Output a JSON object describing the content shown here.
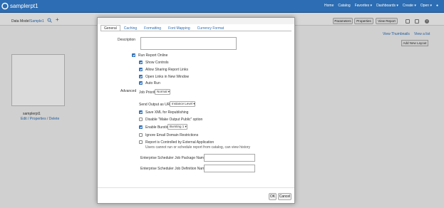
{
  "header": {
    "title": "samplerpt1",
    "nav": [
      "Home",
      "Catalog",
      "Favorites ▾",
      "Dashboards ▾",
      "Create ▾",
      "Open ▾"
    ],
    "brand_color": "#2c6db3"
  },
  "background": {
    "data_model_label": "Data Model",
    "data_model_value": "Sample1",
    "toolbar": {
      "parameters": "Parameters",
      "properties": "Properties",
      "view_report": "View Report"
    },
    "view_thumbnails": "View Thumbnails",
    "view_list": "View a list",
    "add_layout": "Add New Layout",
    "thumbnail": {
      "name": "samplerpt1",
      "edit": "Edit",
      "properties": "Properties",
      "delete": "Delete",
      "sep": "/"
    }
  },
  "dialog": {
    "tabs": [
      {
        "label": "General",
        "active": true
      },
      {
        "label": "Caching",
        "active": false
      },
      {
        "label": "Formatting",
        "active": false
      },
      {
        "label": "Font Mapping",
        "active": false
      },
      {
        "label": "Currency Format",
        "active": false
      }
    ],
    "description_label": "Description",
    "description_value": "",
    "run_online": {
      "label": "Run Report Online",
      "checked": true
    },
    "sub_options": [
      {
        "label": "Show Controls",
        "checked": true
      },
      {
        "label": "Allow Sharing Report Links",
        "checked": true
      },
      {
        "label": "Open Links in New Window",
        "checked": true
      },
      {
        "label": "Auto Run",
        "checked": true
      }
    ],
    "advanced_label": "Advanced",
    "job_priority": {
      "label": "Job Priority",
      "value": "Normal ▾"
    },
    "send_output": {
      "label": "Send Output as URL",
      "value": "Instance Level ▾"
    },
    "save_xml": {
      "label": "Save XML for Republishing",
      "checked": true
    },
    "disable_public": {
      "label": "Disable \"Make Output Public\" option",
      "checked": false
    },
    "bursting": {
      "label": "Enable Bursting",
      "value": "Bursting 1 ▾",
      "checked": true
    },
    "ignore_email": {
      "label": "Ignore Email Domain Restrictions",
      "checked": false
    },
    "external_app": {
      "label": "Report is Controlled by External Application",
      "note": "Users cannot run or schedule report from catalog, can view history",
      "checked": false
    },
    "pkg_name_label": "Enterprise Scheduler Job Package Name",
    "pkg_name_value": "",
    "def_name_label": "Enterprise Scheduler Job Definition Name",
    "def_name_value": "",
    "ok": "OK",
    "cancel": "Cancel"
  }
}
